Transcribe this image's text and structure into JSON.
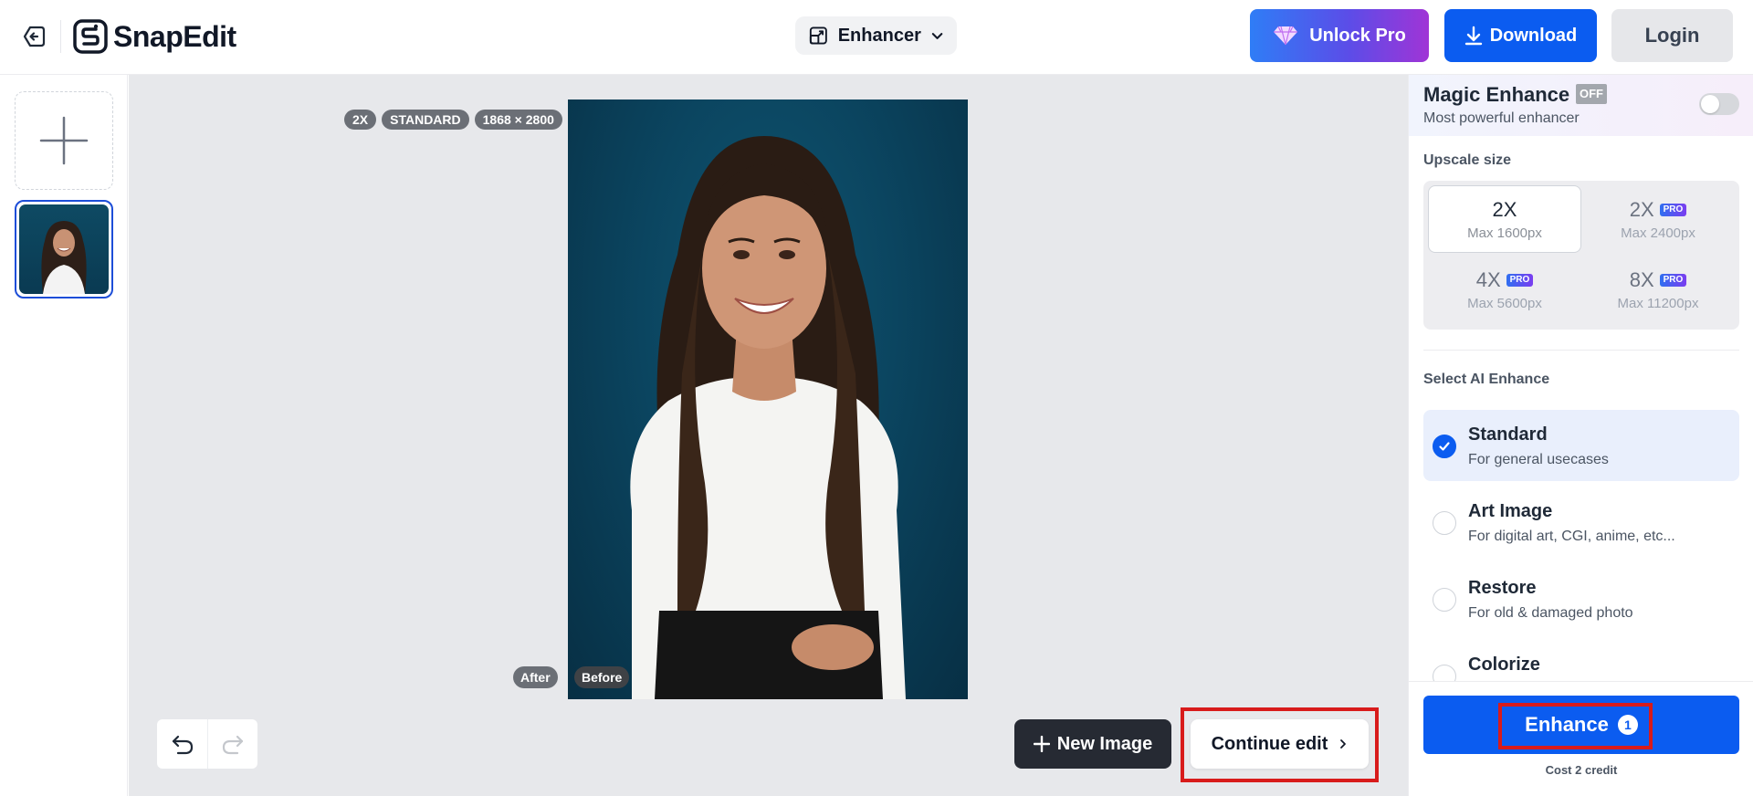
{
  "header": {
    "app_name": "SnapEdit",
    "tool_select": "Enhancer",
    "unlock_pro": "Unlock Pro",
    "download": "Download",
    "login": "Login"
  },
  "canvas": {
    "badges": [
      "2X",
      "STANDARD",
      "1868 × 2800"
    ],
    "after_label": "After",
    "before_label": "Before",
    "new_image": "New Image",
    "continue_edit": "Continue edit"
  },
  "panel": {
    "magic_title": "Magic Enhance",
    "magic_badge": "OFF",
    "magic_sub": "Most powerful enhancer",
    "magic_enabled": false,
    "upscale_label": "Upscale size",
    "sizes": [
      {
        "scale": "2X",
        "max": "Max 1600px",
        "pro": false,
        "selected": true
      },
      {
        "scale": "2X",
        "max": "Max 2400px",
        "pro": true,
        "selected": false
      },
      {
        "scale": "4X",
        "max": "Max 5600px",
        "pro": true,
        "selected": false
      },
      {
        "scale": "8X",
        "max": "Max 11200px",
        "pro": true,
        "selected": false
      }
    ],
    "pro_tag": "PRO",
    "ai_label": "Select AI Enhance",
    "enhance_options": [
      {
        "name": "Standard",
        "desc": "For general usecases",
        "selected": true
      },
      {
        "name": "Art Image",
        "desc": "For digital art, CGI, anime, etc...",
        "selected": false
      },
      {
        "name": "Restore",
        "desc": "For old & damaged photo",
        "selected": false
      },
      {
        "name": "Colorize",
        "desc": "",
        "selected": false
      }
    ],
    "enhance_button": "Enhance",
    "enhance_count": "1",
    "cost": "Cost 2 credit"
  },
  "colors": {
    "primary": "#0b5cf0",
    "highlight": "#d81b1b",
    "dark_button": "#262a33",
    "photo_background": "#0b4560"
  }
}
